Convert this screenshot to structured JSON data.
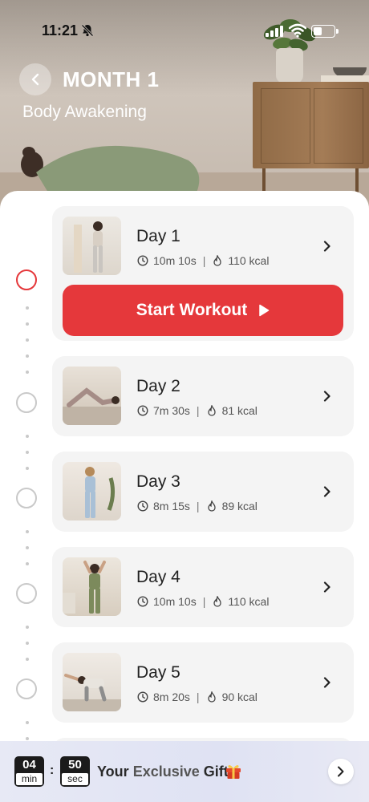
{
  "status_bar": {
    "time": "11:21"
  },
  "header": {
    "title": "MONTH 1",
    "subtitle": "Body Awakening"
  },
  "start_button": {
    "label": "Start Workout"
  },
  "days": [
    {
      "label": "Day 1",
      "duration": "10m 10s",
      "calories": "110 kcal"
    },
    {
      "label": "Day 2",
      "duration": "7m 30s",
      "calories": "81 kcal"
    },
    {
      "label": "Day 3",
      "duration": "8m 15s",
      "calories": "89 kcal"
    },
    {
      "label": "Day 4",
      "duration": "10m 10s",
      "calories": "110 kcal"
    },
    {
      "label": "Day 5",
      "duration": "8m 20s",
      "calories": "90 kcal"
    }
  ],
  "gift": {
    "minutes": "04",
    "minutes_unit": "min",
    "seconds": "50",
    "seconds_unit": "sec",
    "colon": ":",
    "text_your": "Your",
    "text_exclusive": "Exclusive",
    "text_gift": "Gift"
  },
  "colors": {
    "accent": "#e5383b",
    "card": "#f4f4f4"
  },
  "icons": [
    "bell-slash-icon",
    "signal-icon",
    "wifi-icon",
    "battery-icon",
    "back-arrow-icon",
    "clock-icon",
    "flame-icon",
    "chevron-right-icon",
    "play-icon",
    "gift-icon"
  ]
}
